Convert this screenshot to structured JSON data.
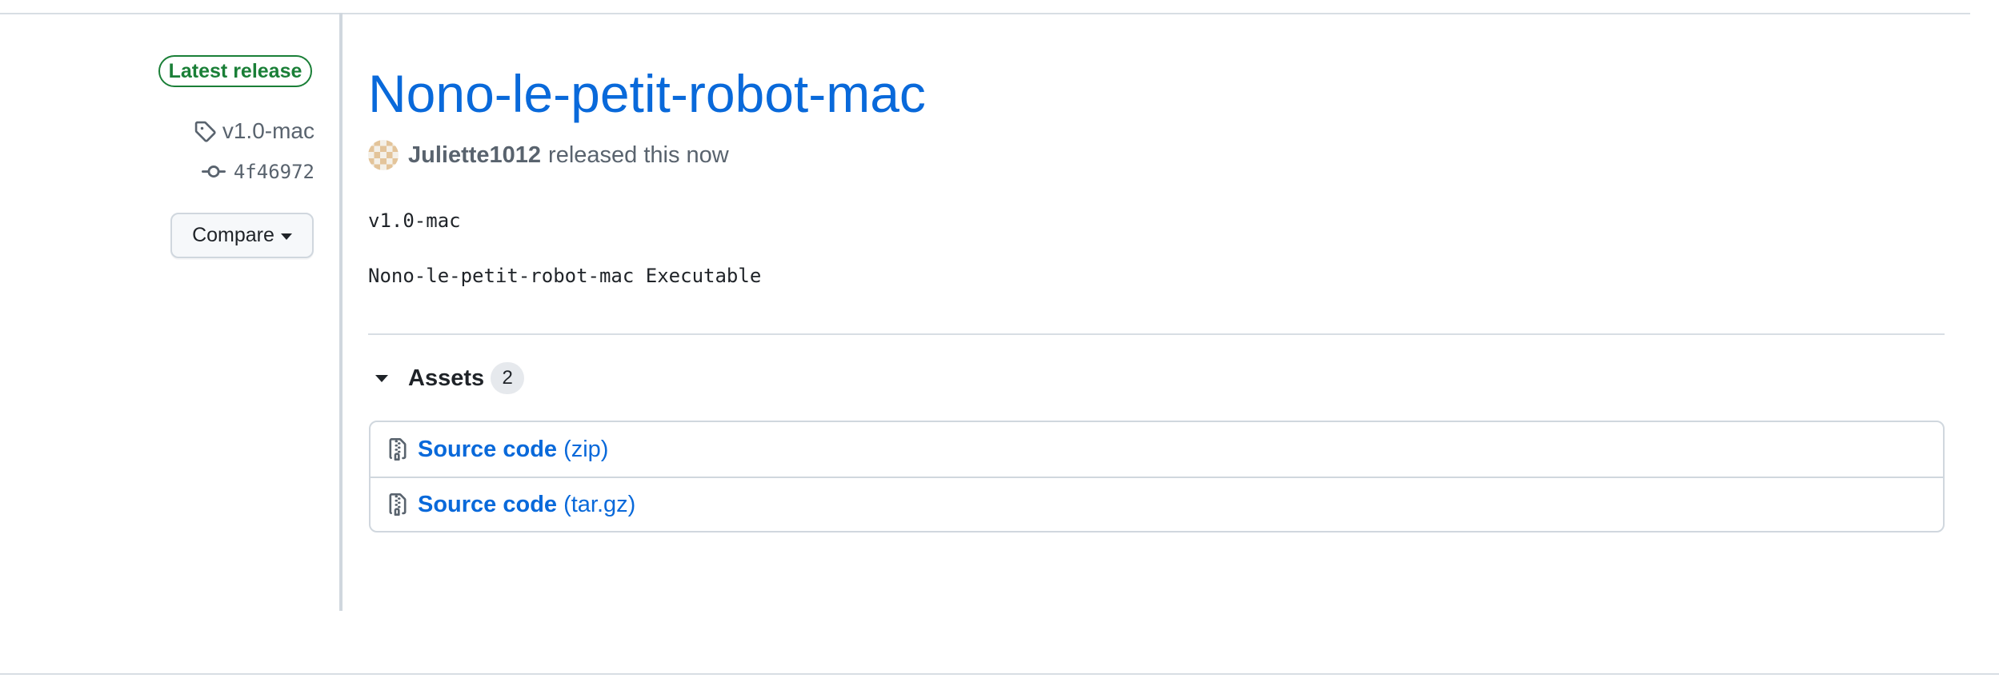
{
  "release": {
    "badge": "Latest release",
    "tag": "v1.0-mac",
    "commit": "4f46972",
    "compare_label": "Compare",
    "title": "Nono-le-petit-robot-mac",
    "author": "Juliette1012",
    "released_text": "released this now",
    "body_lines": [
      "v1.0-mac",
      "Nono-le-petit-robot-mac Executable"
    ]
  },
  "assets": {
    "label": "Assets",
    "count": "2",
    "items": [
      {
        "name": "Source code",
        "format": "(zip)",
        "icon": "file-zip-icon"
      },
      {
        "name": "Source code",
        "format": "(tar.gz)",
        "icon": "file-zip-icon"
      }
    ]
  },
  "colors": {
    "link": "#0969da",
    "success": "#1a7f37",
    "muted": "#59636e",
    "border": "#d0d7de"
  },
  "icons": {
    "tag": "tag-icon",
    "commit": "git-commit-icon",
    "caret": "triangle-down-icon",
    "avatar": "identicon-avatar"
  }
}
